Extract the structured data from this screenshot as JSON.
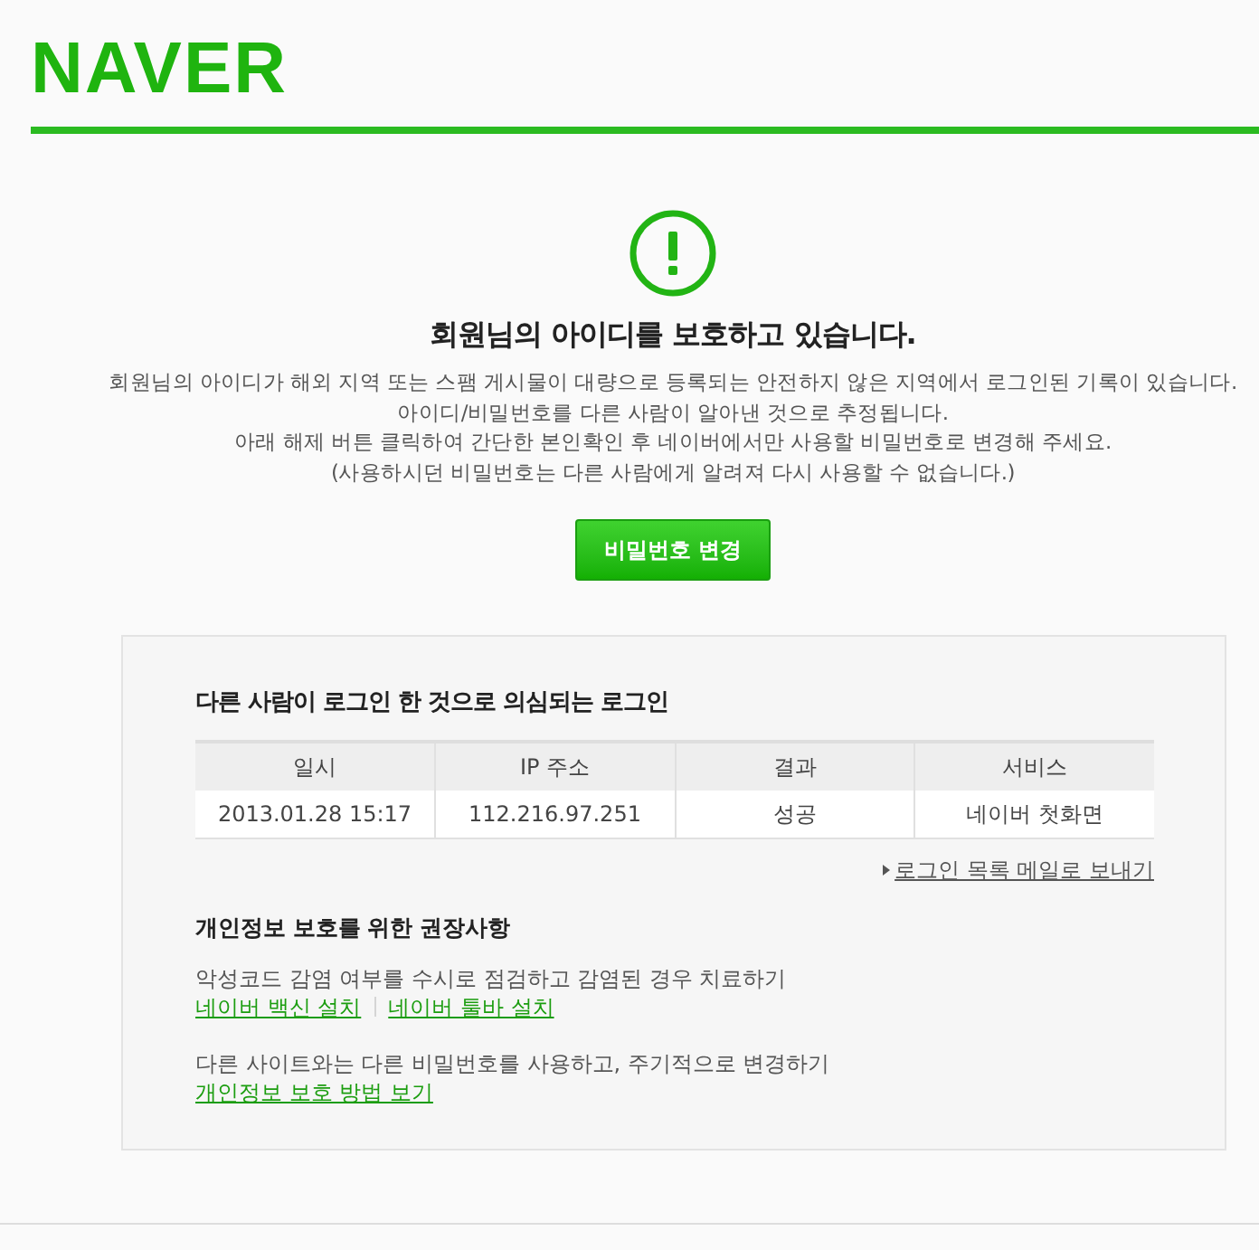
{
  "logo": "NAVER",
  "notice": {
    "title": "회원님의 아이디를 보호하고 있습니다.",
    "lines": [
      "회원님의 아이디가 해외 지역 또는 스팸 게시물이 대량으로 등록되는 안전하지 않은 지역에서 로그인된 기록이 있습니다.",
      "아이디/비밀번호를 다른 사람이 알아낸 것으로 추정됩니다.",
      "아래 해제 버튼 클릭하여 간단한 본인확인 후 네이버에서만 사용할 비밀번호로 변경해 주세요.",
      "(사용하시던 비밀번호는 다른 사람에게 알려져 다시 사용할 수 없습니다.)"
    ],
    "button": "비밀번호 변경"
  },
  "login_log": {
    "title": "다른 사람이 로그인 한 것으로 의심되는 로그인",
    "columns": [
      "일시",
      "IP 주소",
      "결과",
      "서비스"
    ],
    "rows": [
      [
        "2013.01.28 15:17",
        "112.216.97.251",
        "성공",
        "네이버 첫화면"
      ]
    ],
    "mail_link": "로그인 목록 메일로 보내기"
  },
  "tips": {
    "title": "개인정보 보호를 위한 권장사항",
    "items": [
      {
        "text": "악성코드 감염 여부를 수시로 점검하고 감염된 경우 치료하기",
        "links": [
          "네이버 백신 설치",
          "네이버 툴바 설치"
        ]
      },
      {
        "text": "다른 사이트와는 다른 비밀번호를 사용하고, 주기적으로 변경하기",
        "links": [
          "개인정보 보호 방법 보기"
        ]
      }
    ]
  }
}
